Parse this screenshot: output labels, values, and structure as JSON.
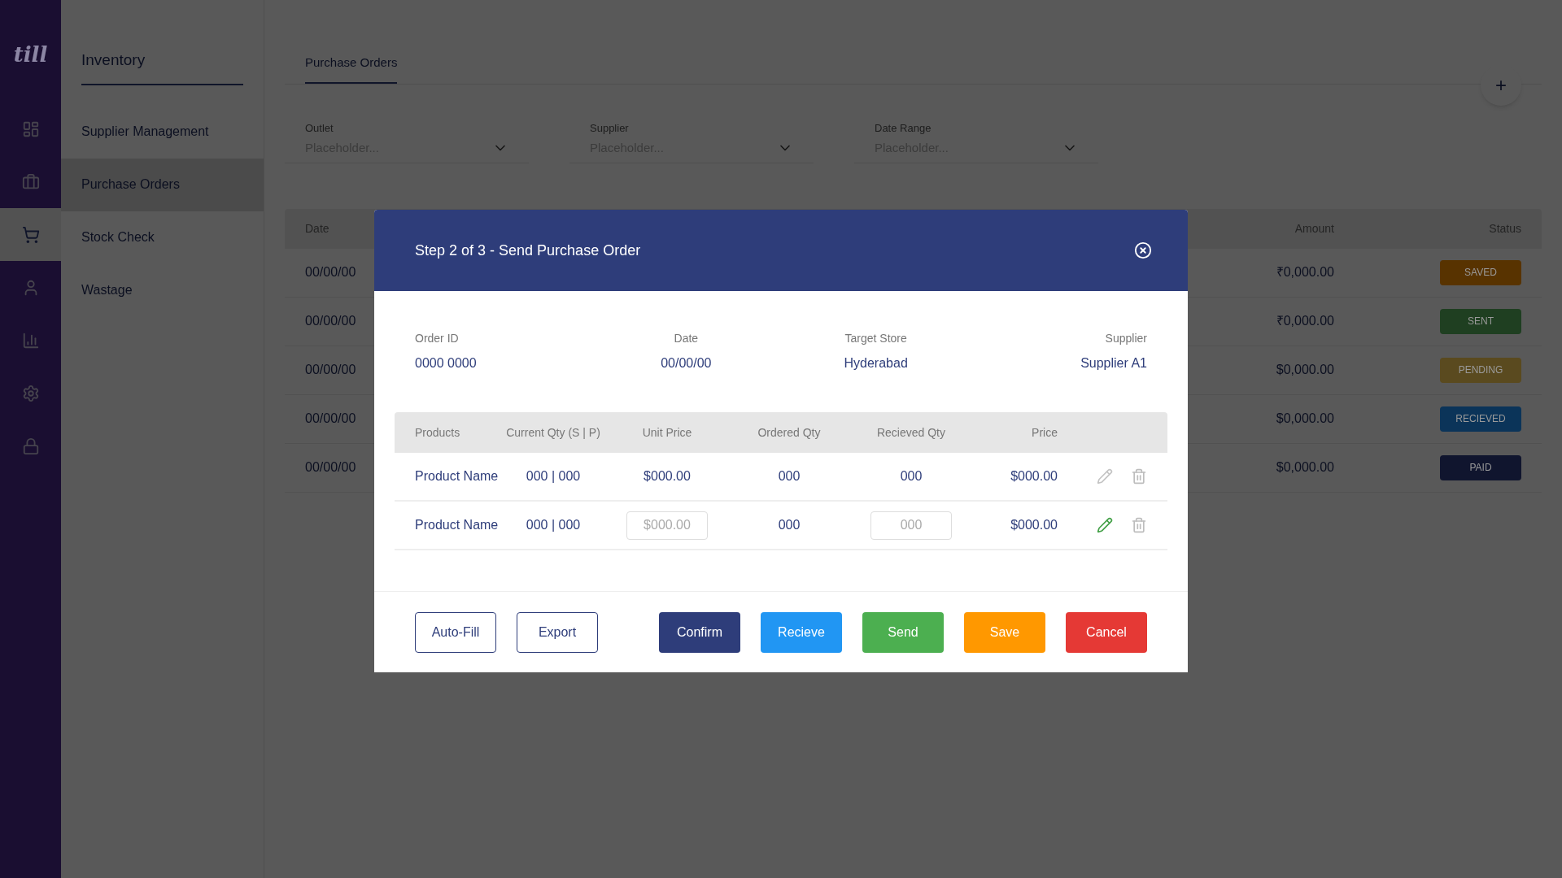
{
  "sidebar": {
    "logo": "till",
    "items": [
      {
        "selected": false
      },
      {
        "selected": false
      },
      {
        "selected": true
      },
      {
        "selected": false
      },
      {
        "selected": false
      },
      {
        "selected": false
      },
      {
        "selected": false
      }
    ]
  },
  "nav": {
    "title": "Inventory",
    "items": [
      {
        "label": "Supplier Management",
        "selected": false
      },
      {
        "label": "Purchase Orders",
        "selected": true
      },
      {
        "label": "Stock Check",
        "selected": false
      },
      {
        "label": "Wastage",
        "selected": false
      }
    ]
  },
  "tabs": [
    {
      "label": "Purchase Orders",
      "selected": true
    }
  ],
  "add_button": "+",
  "filters": [
    {
      "label": "Outlet",
      "placeholder": "Placeholder..."
    },
    {
      "label": "Supplier",
      "placeholder": "Placeholder..."
    },
    {
      "label": "Date Range",
      "placeholder": "Placeholder..."
    }
  ],
  "table": {
    "columns": [
      "Date",
      "Amount",
      "Status"
    ],
    "rows": [
      {
        "date": "00/00/00",
        "amount": "₹0,000.00",
        "status": "SAVED",
        "color": "#583300"
      },
      {
        "date": "00/00/00",
        "amount": "₹0,000.00",
        "status": "SENT",
        "color": "#1f3f21"
      },
      {
        "date": "00/00/00",
        "amount": "$0,000.00",
        "status": "PENDING",
        "color": "#5a4a1f"
      },
      {
        "date": "00/00/00",
        "amount": "$0,000.00",
        "status": "RECIEVED",
        "color": "#0b3459"
      },
      {
        "date": "00/00/00",
        "amount": "$0,000.00",
        "status": "PAID",
        "color": "#10152e"
      }
    ]
  },
  "modal": {
    "title": "Step 2 of 3 - Send Purchase Order",
    "info": [
      {
        "label": "Order ID",
        "value": "0000 0000"
      },
      {
        "label": "Date",
        "value": "00/00/00"
      },
      {
        "label": "Target Store",
        "value": "Hyderabad"
      },
      {
        "label": "Supplier",
        "value": "Supplier A1"
      }
    ],
    "columns": [
      "Products",
      "Current Qty (S | P)",
      "Unit Price",
      "Ordered Qty",
      "Recieved Qty",
      "Price"
    ],
    "rows": [
      {
        "kind": "text",
        "product": "Product Name",
        "current_qty": "000 | 000",
        "unit_price": "$000.00",
        "ordered_qty": "000",
        "received_qty": "000",
        "price": "$000.00",
        "editing": false
      },
      {
        "kind": "fields",
        "product": "Product Name",
        "current_qty": "000 | 000",
        "unit_price_field": {
          "placeholder": "$000.00"
        },
        "ordered_qty": "000",
        "received_qty_field": {
          "placeholder": "000"
        },
        "price": "$000.00",
        "editing": true
      }
    ],
    "buttons": [
      {
        "label": "Auto-Fill",
        "kind": "outline",
        "color": "#2e3d7a"
      },
      {
        "label": "Export",
        "kind": "outline",
        "color": "#2e3d7a"
      },
      {
        "label": "Confirm",
        "kind": "filled",
        "color": "#2e3d7a"
      },
      {
        "label": "Recieve",
        "kind": "filled",
        "color": "#2196f3"
      },
      {
        "label": "Send",
        "kind": "filled",
        "color": "#4caf50"
      },
      {
        "label": "Save",
        "kind": "filled",
        "color": "#ff9800"
      },
      {
        "label": "Cancel",
        "kind": "filled",
        "color": "#e53935"
      }
    ]
  }
}
